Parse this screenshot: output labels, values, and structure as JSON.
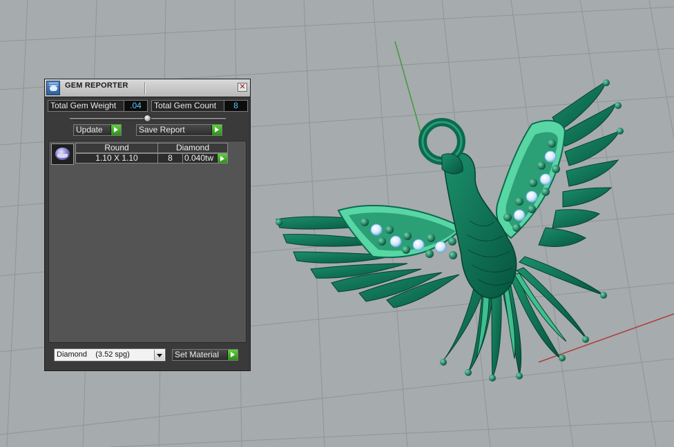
{
  "panel": {
    "title": "GEM REPORTER",
    "close_glyph": "✕",
    "total_weight_label": "Total Gem Weight",
    "total_weight_value": ".04",
    "total_count_label": "Total Gem Count",
    "total_count_value": "8",
    "update_label": "Update",
    "save_report_label": "Save Report",
    "table": {
      "headers": [
        "Round",
        "Diamond"
      ],
      "rows": [
        {
          "size": "1.10 X 1.10",
          "count": "8",
          "weight": "0.040tw"
        }
      ]
    },
    "material_selected": "Diamond    (3.52 spg)",
    "set_material_label": "Set Material"
  },
  "colors": {
    "viewport_bg": "#a6abad",
    "grid": "#8f9497",
    "y_axis": "#3f9a3a",
    "x_axis": "#b03a3a",
    "pendant_dark": "#0b6a4f",
    "pendant_light": "#58d6a4",
    "stone_blue": "#cfe9ff",
    "panel_bg": "#3a3a3a",
    "value_text": "#5ec7ff"
  },
  "icons": [
    "gem-reporter-app-icon",
    "close-icon",
    "play-arrow-icon",
    "dropdown-arrow-icon",
    "gem-thumbnail-icon"
  ]
}
